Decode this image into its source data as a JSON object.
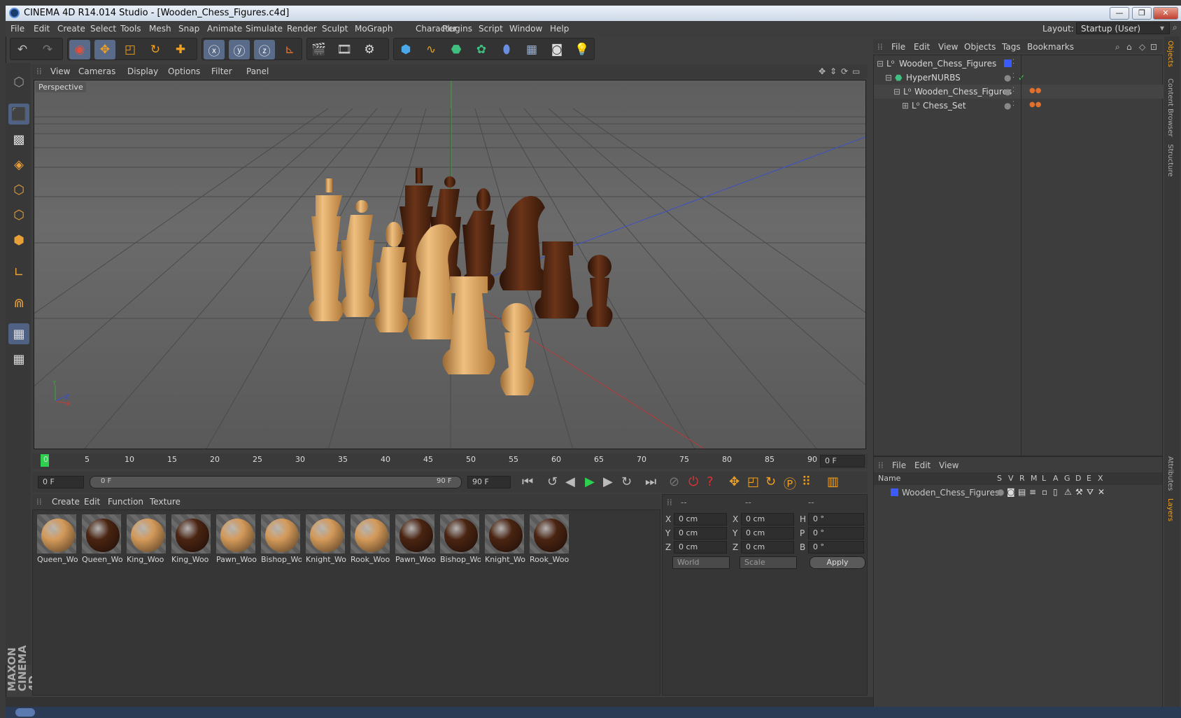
{
  "window": {
    "title": "CINEMA 4D R14.014 Studio - [Wooden_Chess_Figures.c4d]",
    "min": "—",
    "restore": "❐",
    "close": "✕"
  },
  "menu": [
    "File",
    "Edit",
    "Create",
    "Select",
    "Tools",
    "Mesh",
    "Snap",
    "Animate",
    "Simulate",
    "Render",
    "Sculpt",
    "MoGraph",
    "Character",
    "Plugins",
    "Script",
    "Window",
    "Help"
  ],
  "layout": {
    "label": "Layout:",
    "value": "Startup (User)"
  },
  "viewport": {
    "menu": [
      "View",
      "Cameras",
      "Display",
      "Options",
      "Filter",
      "Panel"
    ],
    "label": "Perspective",
    "axis": {
      "y": "Y",
      "x": "X",
      "z": "Z"
    }
  },
  "object_manager": {
    "menu": [
      "File",
      "Edit",
      "View",
      "Objects",
      "Tags",
      "Bookmarks"
    ],
    "items": [
      {
        "name": "Wooden_Chess_Figures"
      },
      {
        "name": "HyperNURBS"
      },
      {
        "name": "Wooden_Chess_Figures"
      },
      {
        "name": "Chess_Set"
      }
    ]
  },
  "timeline": {
    "ticks": [
      "0",
      "5",
      "10",
      "15",
      "20",
      "25",
      "30",
      "35",
      "40",
      "45",
      "50",
      "55",
      "60",
      "65",
      "70",
      "75",
      "80",
      "85",
      "90"
    ],
    "current_frame": "0 F",
    "start": "0 F",
    "range_start": "0 F",
    "range_end": "90 F",
    "end": "90 F"
  },
  "materials": {
    "menu": [
      "Create",
      "Edit",
      "Function",
      "Texture"
    ],
    "items": [
      {
        "label": "Queen_Wo",
        "color": "#d49a5a"
      },
      {
        "label": "Queen_Wo",
        "color": "#4a2412"
      },
      {
        "label": "King_Woo",
        "color": "#d49a5a"
      },
      {
        "label": "King_Woo",
        "color": "#4a2412"
      },
      {
        "label": "Pawn_Woo",
        "color": "#d49a5a"
      },
      {
        "label": "Bishop_Wo",
        "color": "#d49a5a"
      },
      {
        "label": "Knight_Wo",
        "color": "#d49a5a"
      },
      {
        "label": "Rook_Woo",
        "color": "#d49a5a"
      },
      {
        "label": "Pawn_Woo",
        "color": "#4a2412"
      },
      {
        "label": "Bishop_Wo",
        "color": "#4a2412"
      },
      {
        "label": "Knight_Wo",
        "color": "#4a2412"
      },
      {
        "label": "Rook_Woo",
        "color": "#4a2412"
      }
    ]
  },
  "coordinates": {
    "headers": [
      "--",
      "--",
      "--"
    ],
    "rows": [
      {
        "a": "X",
        "av": "0 cm",
        "b": "X",
        "bv": "0 cm",
        "c": "H",
        "cv": "0 °"
      },
      {
        "a": "Y",
        "av": "0 cm",
        "b": "Y",
        "bv": "0 cm",
        "c": "P",
        "cv": "0 °"
      },
      {
        "a": "Z",
        "av": "0 cm",
        "b": "Z",
        "bv": "0 cm",
        "c": "B",
        "cv": "0 °"
      }
    ],
    "world": "World",
    "scale": "Scale",
    "apply": "Apply"
  },
  "layer_manager": {
    "menu": [
      "File",
      "Edit",
      "View"
    ],
    "columns": [
      "Name",
      "S",
      "V",
      "R",
      "M",
      "L",
      "A",
      "G",
      "D",
      "E",
      "X"
    ],
    "item": "Wooden_Chess_Figures"
  },
  "right_tabs": [
    "Objects",
    "Content Browser",
    "Structure",
    "Attributes",
    "Layers"
  ],
  "brand": "MAXON CINEMA 4D",
  "colors": {
    "accent": "#f0a020",
    "selected": "#4f6283",
    "layer_blue": "#3a5cff",
    "check_green": "#44d04a"
  }
}
